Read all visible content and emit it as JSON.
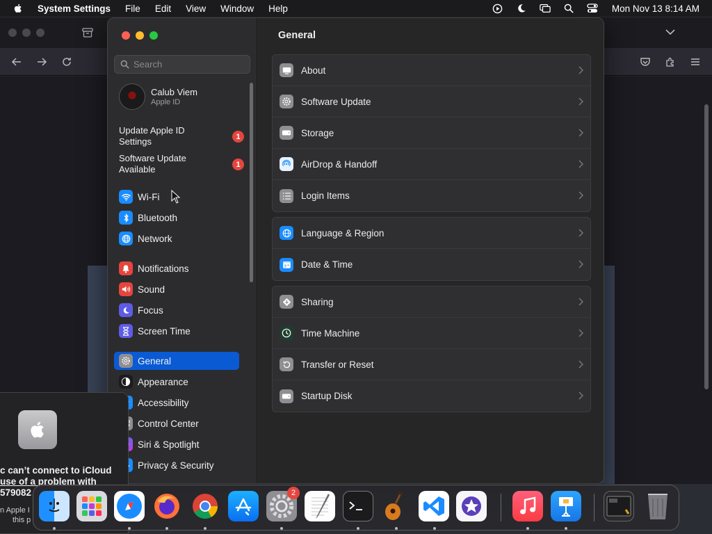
{
  "menubar": {
    "app_name": "System Settings",
    "menus": [
      "File",
      "Edit",
      "View",
      "Window",
      "Help"
    ],
    "clock": "Mon Nov 13  8:14 AM"
  },
  "sidebar": {
    "search_placeholder": "Search",
    "account": {
      "name": "Calub Viem",
      "subtitle": "Apple ID"
    },
    "notices": [
      {
        "label": "Update Apple ID Settings",
        "badge": "1"
      },
      {
        "label": "Software Update Available",
        "badge": "1"
      }
    ],
    "items": [
      {
        "label": "Wi-Fi",
        "icon": "wifi-icon",
        "color": "#1a8cff"
      },
      {
        "label": "Bluetooth",
        "icon": "bluetooth-icon",
        "color": "#1a8cff"
      },
      {
        "label": "Network",
        "icon": "globe-icon",
        "color": "#1a8cff"
      },
      {
        "label": "Notifications",
        "icon": "bell-icon",
        "color": "#e5453f"
      },
      {
        "label": "Sound",
        "icon": "speaker-icon",
        "color": "#e5453f"
      },
      {
        "label": "Focus",
        "icon": "moon-icon",
        "color": "#5e5ce6"
      },
      {
        "label": "Screen Time",
        "icon": "hourglass-icon",
        "color": "#5e5ce6"
      },
      {
        "label": "General",
        "icon": "gear-icon",
        "color": "#8e8e93",
        "selected": true
      },
      {
        "label": "Appearance",
        "icon": "appearance-icon",
        "color": "#1c1c1e"
      },
      {
        "label": "Accessibility",
        "icon": "accessibility-icon",
        "color": "#1a8cff"
      },
      {
        "label": "Control Center",
        "icon": "control-center-icon",
        "color": "#8e8e93"
      },
      {
        "label": "Siri & Spotlight",
        "icon": "siri-icon",
        "color": "#7d4cdb"
      },
      {
        "label": "Privacy & Security",
        "icon": "hand-icon",
        "color": "#1a8cff"
      }
    ]
  },
  "main": {
    "title": "General",
    "groups": [
      [
        {
          "label": "About",
          "icon": "display-icon"
        },
        {
          "label": "Software Update",
          "icon": "gear-badge-icon"
        },
        {
          "label": "Storage",
          "icon": "drive-icon"
        },
        {
          "label": "AirDrop & Handoff",
          "icon": "airdrop-icon"
        },
        {
          "label": "Login Items",
          "icon": "list-icon"
        }
      ],
      [
        {
          "label": "Language & Region",
          "icon": "globe-icon"
        },
        {
          "label": "Date & Time",
          "icon": "calendar-icon"
        }
      ],
      [
        {
          "label": "Sharing",
          "icon": "sharing-icon"
        },
        {
          "label": "Time Machine",
          "icon": "time-machine-icon"
        },
        {
          "label": "Transfer or Reset",
          "icon": "reset-icon"
        },
        {
          "label": "Startup Disk",
          "icon": "disk-icon"
        }
      ]
    ]
  },
  "notification": {
    "line1": "c can’t connect to iCloud",
    "line2": "use of a problem with",
    "line3": "579082",
    "line4": "n Apple I",
    "line5": "this p"
  },
  "dock": {
    "apps": [
      "Finder",
      "Launchpad",
      "Safari",
      "Firefox",
      "Chrome",
      "App Store",
      "System Settings",
      "TextEdit",
      "Terminal",
      "GarageBand",
      "VS Code",
      "iMovie",
      "Music",
      "Keynote",
      "Screenshot",
      "Trash"
    ],
    "settings_badge": "2"
  }
}
